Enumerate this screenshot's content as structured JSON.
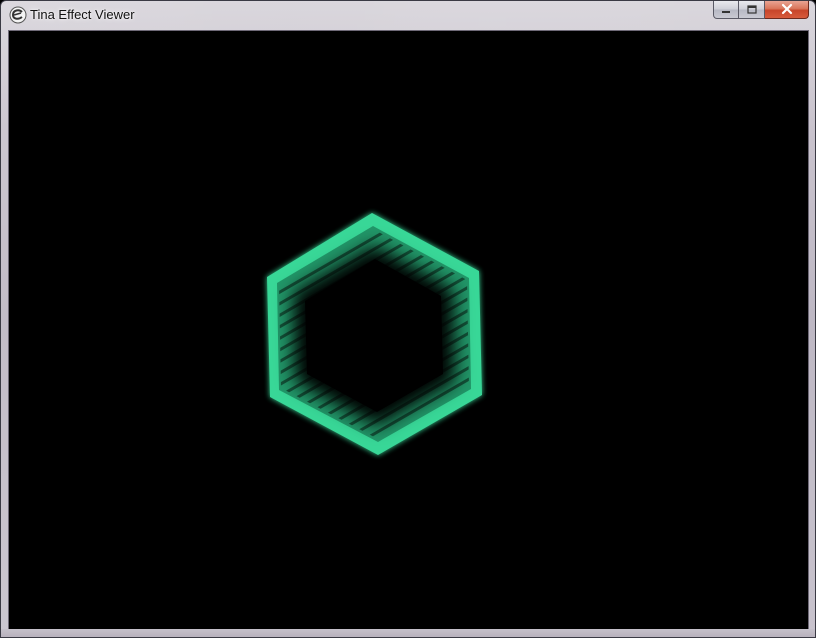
{
  "window": {
    "title": "Tina Effect Viewer",
    "app_icon": "tina-logo-icon",
    "caption_buttons": {
      "minimize_icon": "minimize-icon",
      "maximize_icon": "maximize-icon",
      "close_icon": "close-icon"
    }
  },
  "viewport": {
    "background": "#000000",
    "effect": {
      "shape": "hexagon",
      "glow_color": "#3be3a0",
      "inner_color": "#000000"
    }
  }
}
